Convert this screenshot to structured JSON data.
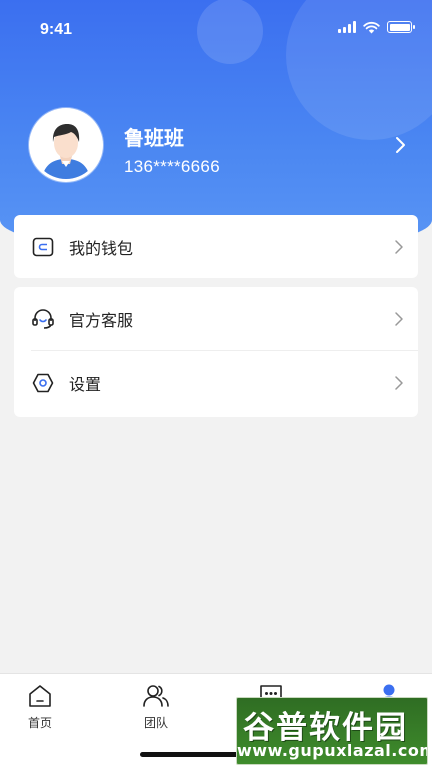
{
  "status_bar": {
    "time": "9:41"
  },
  "profile": {
    "name": "鲁班班",
    "phone": "136****6666"
  },
  "menu": {
    "wallet": {
      "label": "我的钱包",
      "icon": "wallet-icon"
    },
    "service": {
      "label": "官方客服",
      "icon": "headset-icon"
    },
    "settings": {
      "label": "设置",
      "icon": "gear-icon"
    }
  },
  "tabbar": {
    "tabs": [
      {
        "label": "首页",
        "icon": "home-icon"
      },
      {
        "label": "团队",
        "icon": "team-icon"
      },
      {
        "label": "",
        "icon": "message-icon"
      },
      {
        "label": "",
        "icon": "user-icon",
        "active": true
      }
    ]
  },
  "watermark": {
    "title": "谷普软件园",
    "url": "www.gupuxlazal.com"
  },
  "colors": {
    "primary": "#3b6ff0",
    "background": "#f2f2f2",
    "card": "#ffffff"
  }
}
